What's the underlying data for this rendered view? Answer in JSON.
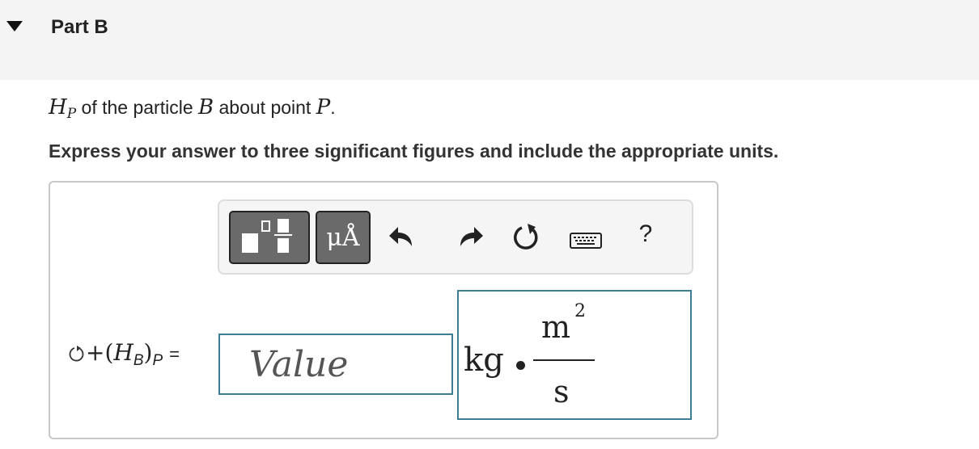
{
  "header": {
    "title": "Part B",
    "collapse_icon": "triangle-down-icon"
  },
  "question": {
    "symbol_H": "H",
    "symbol_sub_P": "P",
    "text_1": " of the particle ",
    "symbol_B": "B",
    "text_2": " about point ",
    "symbol_P": "P",
    "text_3": "."
  },
  "instruction": "Express your answer to three significant figures and include the appropriate units.",
  "toolbar": {
    "templates_icon": "templates-icon",
    "units_label": "μÅ",
    "undo_icon": "undo-icon",
    "redo_icon": "redo-icon",
    "reset_icon": "reset-icon",
    "keyboard_icon": "keyboard-icon",
    "help_label": "?"
  },
  "answer": {
    "reset_icon": "reset-icon",
    "lhs_plus": "+(",
    "lhs_H": "H",
    "lhs_sub_B": "B",
    "lhs_close": ")",
    "lhs_sub_P": "P",
    "equals": "=",
    "value_placeholder": "Value",
    "units": {
      "kg": "kg",
      "numerator": "m",
      "exponent": "2",
      "denominator": "s"
    }
  },
  "colors": {
    "header_bg": "#f4f4f4",
    "input_border": "#3e7d96",
    "tool_button_bg": "#6a6a6a"
  }
}
